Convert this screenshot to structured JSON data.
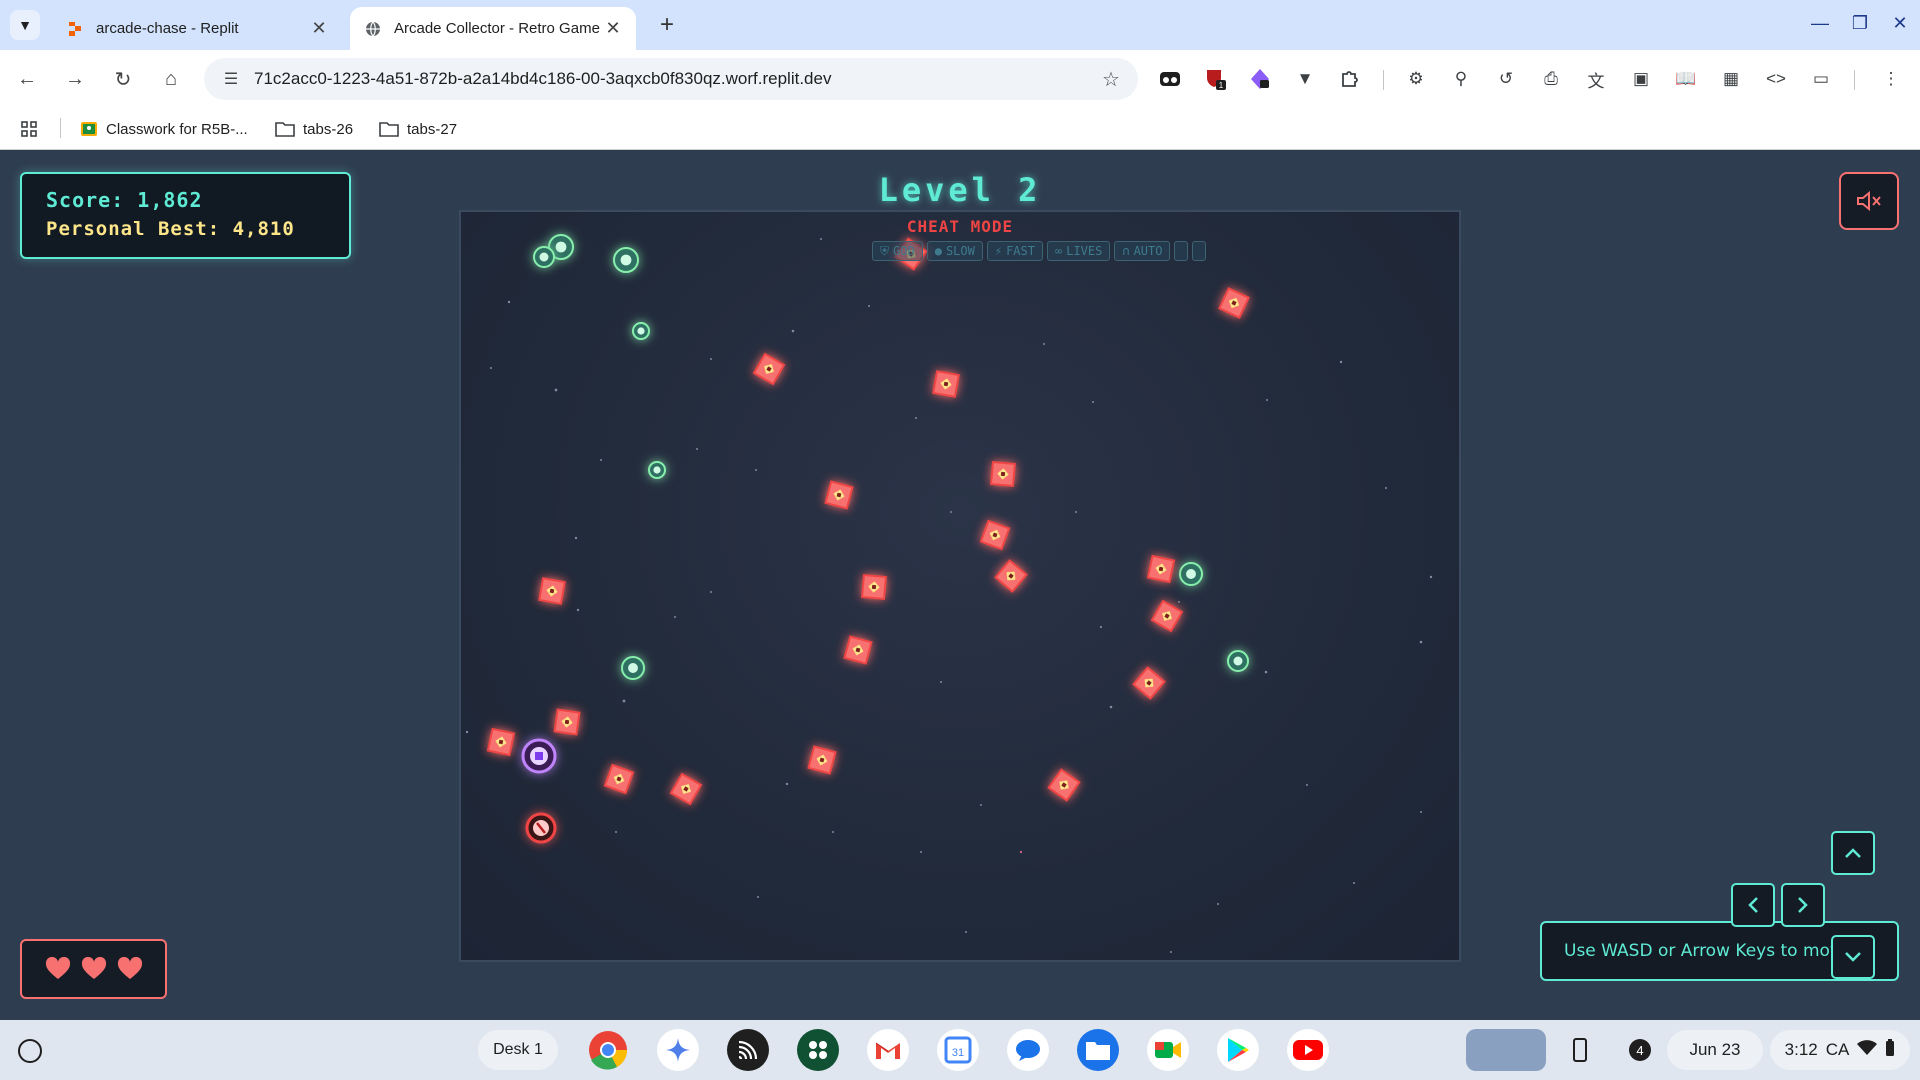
{
  "browser": {
    "tabs": [
      {
        "title": "arcade-chase - Replit",
        "active": false
      },
      {
        "title": "Arcade Collector - Retro Game",
        "active": true
      }
    ],
    "url": "71c2acc0-1223-4a51-872b-a2a14bd4c186-00-3aqxcb0f830qz.worf.replit.dev",
    "bookmarks": [
      {
        "label": "Classwork for R5B-...",
        "icon": "classroom-icon"
      },
      {
        "label": "tabs-26",
        "icon": "folder-icon"
      },
      {
        "label": "tabs-27",
        "icon": "folder-icon"
      }
    ],
    "extension_badge": "1"
  },
  "game": {
    "score_label": "Score:",
    "score_value": "1,862",
    "best_label": "Personal Best:",
    "best_value": "4,810",
    "level_title": "Level 2",
    "cheat_title": "CHEAT MODE",
    "cheat_buttons": [
      {
        "label": "GOD",
        "icon": "shield-icon"
      },
      {
        "label": "SLOW",
        "icon": "snail-icon"
      },
      {
        "label": "FAST",
        "icon": "lightning-icon"
      },
      {
        "label": "LIVES",
        "icon": "infinity-icon"
      },
      {
        "label": "AUTO",
        "icon": "magnet-icon"
      }
    ],
    "lives": 3,
    "hint": "Use WASD or Arrow Keys to move",
    "colors": {
      "accent": "#5eead4",
      "danger": "#f87171",
      "best": "#fde68a",
      "enemy": "#ef4444"
    }
  },
  "shelf": {
    "desk_label": "Desk 1",
    "apps": [
      "chrome-icon",
      "gemini-icon",
      "cast-icon",
      "google-classroom-icon",
      "gmail-icon",
      "calendar-icon",
      "messages-icon",
      "files-icon",
      "meet-icon",
      "play-store-icon",
      "youtube-icon"
    ],
    "calendar_day": "31",
    "notification_count": "4",
    "date": "Jun 23",
    "time": "3:12",
    "region": "CA"
  }
}
